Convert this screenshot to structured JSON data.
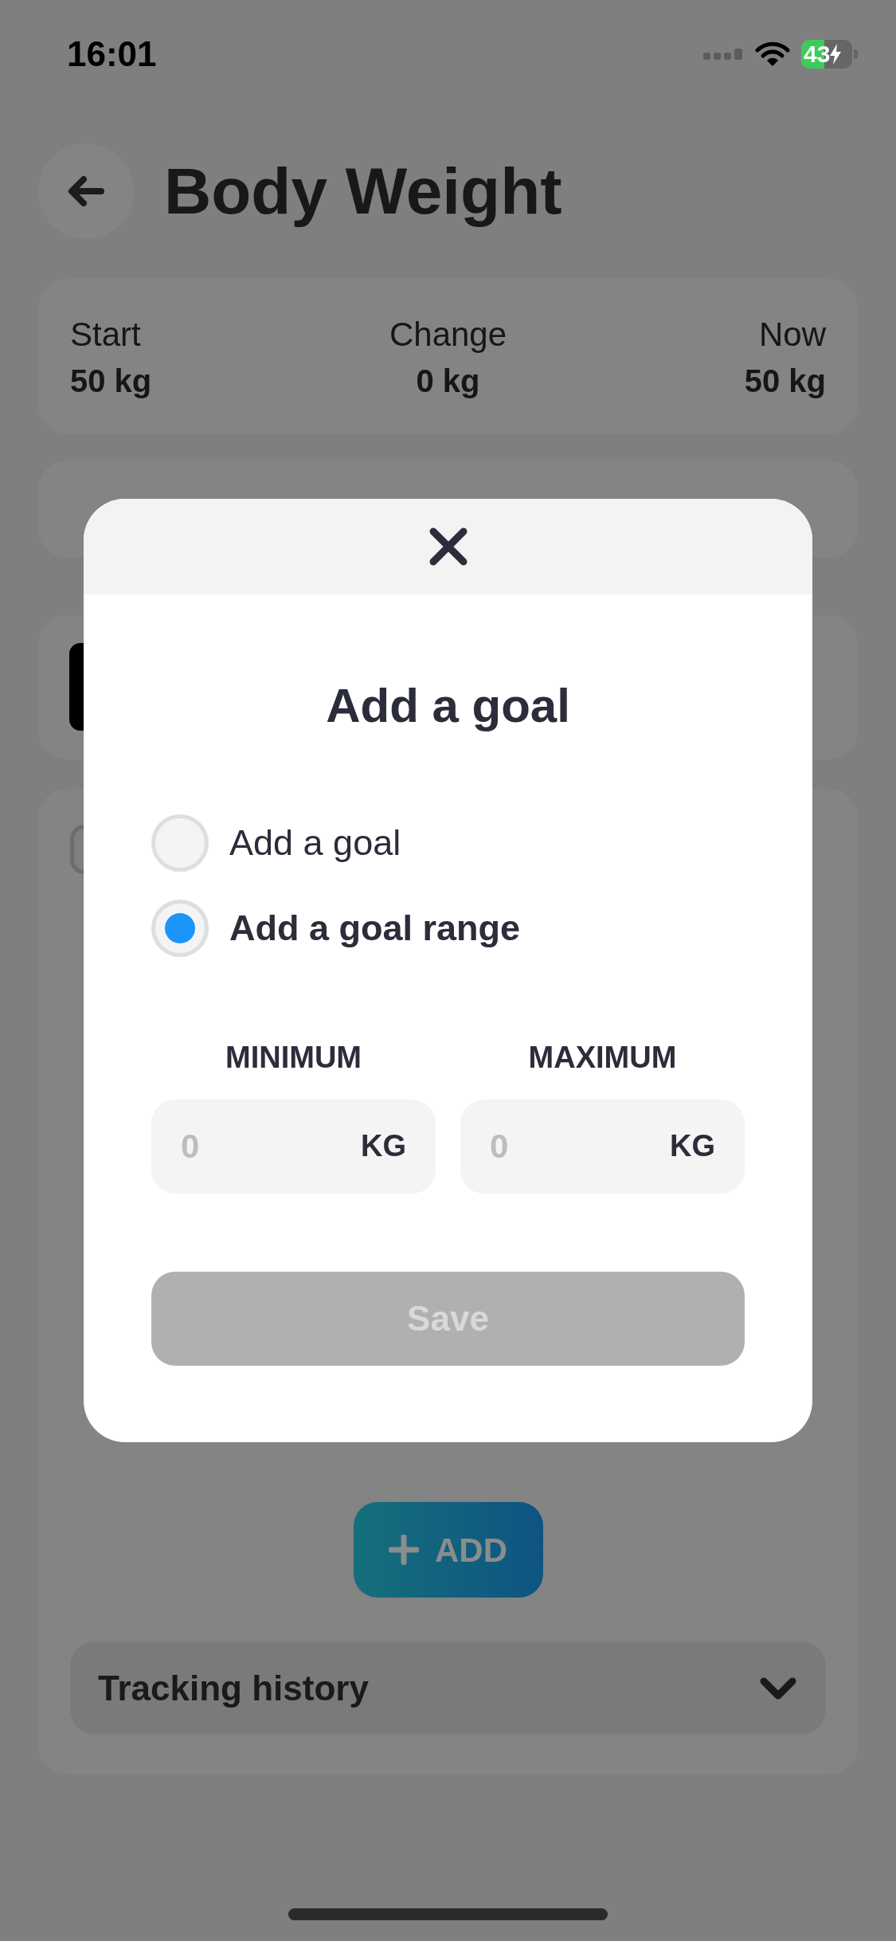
{
  "status_bar": {
    "time": "16:01",
    "battery": "43"
  },
  "header": {
    "title": "Body Weight"
  },
  "stats": [
    {
      "label": "Start",
      "value": "50 kg"
    },
    {
      "label": "Change",
      "value": "0 kg"
    },
    {
      "label": "Now",
      "value": "50 kg"
    }
  ],
  "add_button": {
    "label": "ADD"
  },
  "tracking_history": {
    "label": "Tracking history",
    "expanded": false
  },
  "modal": {
    "title": "Add a goal",
    "options": [
      {
        "label": "Add a goal",
        "selected": false
      },
      {
        "label": "Add a goal range",
        "selected": true
      }
    ],
    "fields": [
      {
        "label": "MINIMUM",
        "placeholder": "0",
        "unit": "KG"
      },
      {
        "label": "MAXIMUM",
        "placeholder": "0",
        "unit": "KG"
      }
    ],
    "save_button": {
      "label": "Save",
      "disabled": true
    }
  }
}
